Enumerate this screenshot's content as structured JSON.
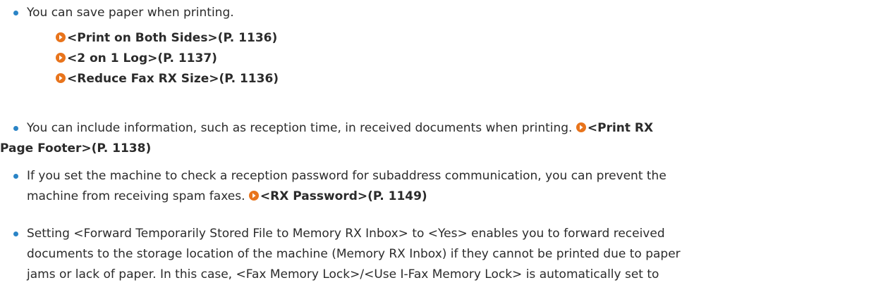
{
  "colors": {
    "bullet": "#2a84c6",
    "link_icon": "#e8741c",
    "text": "#2b2b2b"
  },
  "icons": {
    "bullet": "bullet-dot-icon",
    "link": "orange-right-arrow-circle-icon"
  },
  "items": [
    {
      "text": "You can save paper when printing.",
      "links": [
        "<Print on Both Sides>(P. 1136)",
        "<2 on 1 Log>(P. 1137)",
        "<Reduce Fax RX Size>(P. 1136)"
      ]
    },
    {
      "text_line1": "You can include information, such as reception time, in received documents when printing. ",
      "link_part1": "<Print RX",
      "link_part2": "Page Footer>(P. 1138)"
    },
    {
      "text_line1": "If you set the machine to check a reception password for subaddress communication, you can prevent the",
      "text_line2": "machine from receiving spam faxes. ",
      "link": "<RX Password>(P. 1149)"
    },
    {
      "text_line1": "Setting <Forward Temporarily Stored File to Memory RX Inbox> to <Yes> enables you to forward received",
      "text_line2": "documents to the storage location of the machine (Memory RX Inbox) if they cannot be printed due to paper",
      "text_line3": "jams or lack of paper. In this case, <Fax Memory Lock>/<Use I-Fax Memory Lock> is automatically set to"
    }
  ]
}
